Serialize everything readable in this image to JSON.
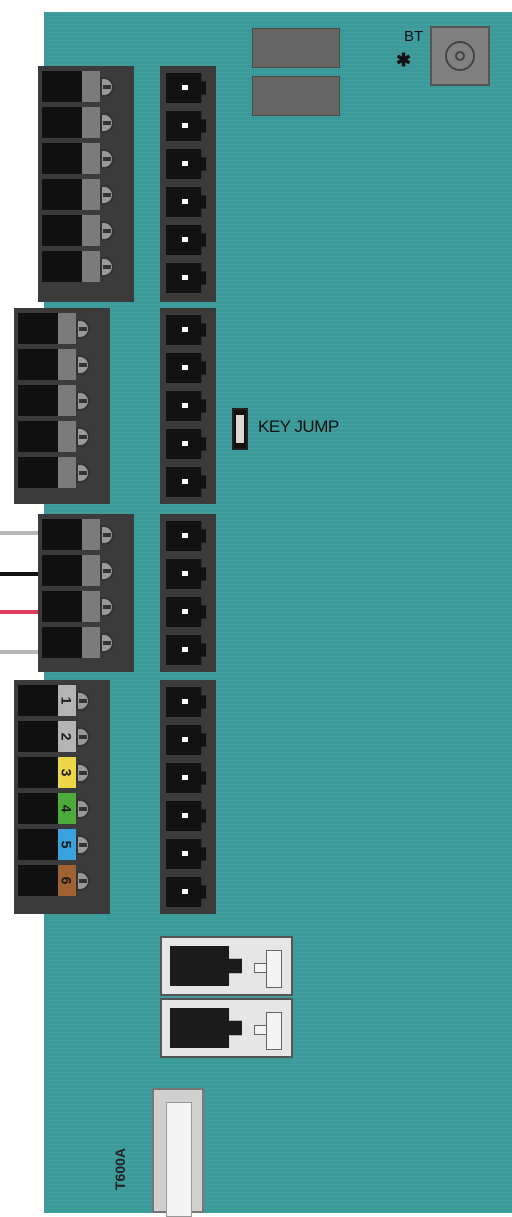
{
  "bt": {
    "label": "BT",
    "symbol": "✱"
  },
  "key_jump": {
    "label": "KEY JUMP"
  },
  "fuse": {
    "label": "T600A"
  },
  "connector_numbers": [
    "1",
    "2",
    "3",
    "4",
    "5",
    "6"
  ],
  "connector_colors": {
    "1": "#b4b4b4",
    "2": "#b4b4b4",
    "3": "#ecd64a",
    "4": "#4cab3a",
    "5": "#3aa2dc",
    "6": "#a16233"
  },
  "wire_colors": [
    "#b8b8b8",
    "#111111",
    "#e03a5c",
    "#b8b8b8"
  ],
  "colors": {
    "board": "#3c9a9a",
    "terminal_dark": "#111111",
    "terminal_frame": "#3b3b3b"
  }
}
